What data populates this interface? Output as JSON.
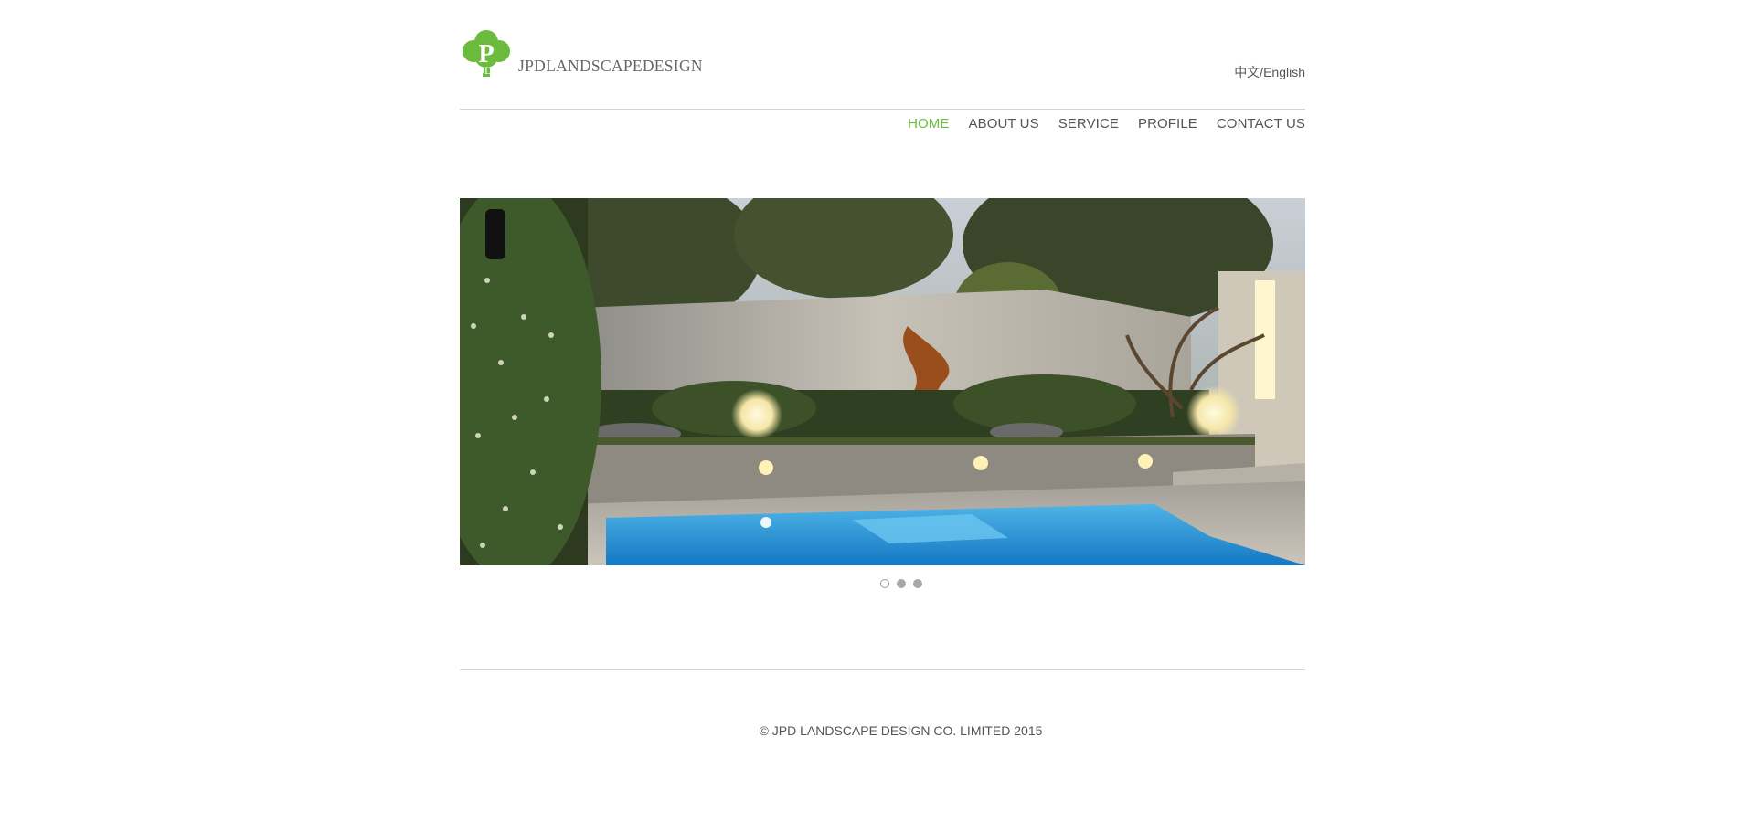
{
  "brand": {
    "name": "JPDLANDSCAPEDESIGN",
    "logo_color": "#6cbb3c"
  },
  "header": {
    "language_switch": "中文/English"
  },
  "nav": {
    "items": [
      {
        "label": "HOME",
        "active": true
      },
      {
        "label": "ABOUT US",
        "active": false
      },
      {
        "label": "SERVICE",
        "active": false
      },
      {
        "label": "PROFILE",
        "active": false
      },
      {
        "label": "CONTACT US",
        "active": false
      }
    ],
    "active_color": "#6cbb3c"
  },
  "slider": {
    "slide_count": 3,
    "active_index": 0,
    "current_slide": "garden-pool-at-night"
  },
  "footer": {
    "copyright": "© JPD LANDSCAPE DESIGN CO. LIMITED 2015"
  }
}
